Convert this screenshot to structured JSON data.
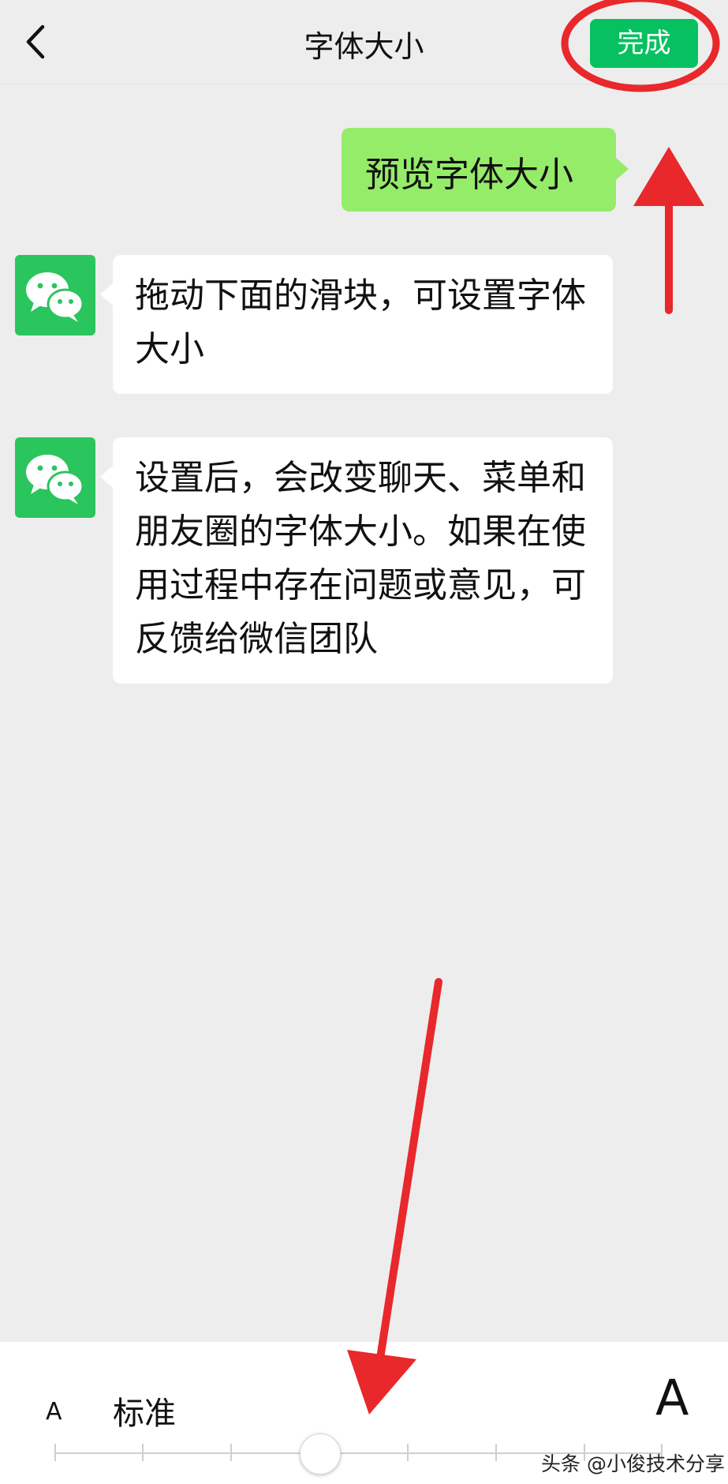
{
  "header": {
    "title": "字体大小",
    "done_label": "完成"
  },
  "chat": {
    "preview_bubble": "预览字体大小",
    "messages": [
      "拖动下面的滑块，可设置字体大小",
      "设置后，会改变聊天、菜单和朋友圈的字体大小。如果在使用过程中存在问题或意见，可反馈给微信团队"
    ]
  },
  "font_slider": {
    "small_label": "A",
    "current_label": "标准",
    "large_label": "A",
    "level": 3,
    "levels_total": 9
  },
  "watermark": "头条 @小俊技术分享",
  "colors": {
    "accent_green": "#07c160",
    "preview_bubble": "#95ec69",
    "annotation_red": "#e8282b",
    "background": "#ededed"
  },
  "icons": {
    "back": "chevron-left-icon",
    "avatar": "wechat-logo-icon"
  }
}
